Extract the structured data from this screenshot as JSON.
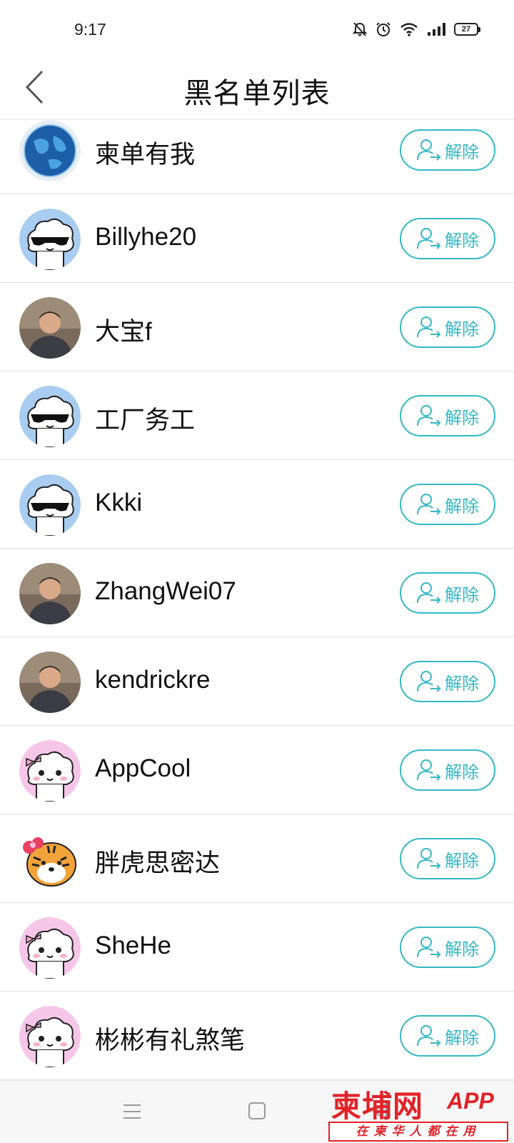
{
  "status_bar": {
    "time": "9:17",
    "battery": "27",
    "icons": [
      "bell-off-icon",
      "alarm-icon",
      "wifi-icon",
      "signal-icon",
      "battery-icon"
    ]
  },
  "header": {
    "title": "黑名单列表",
    "back_icon": "chevron-left-icon"
  },
  "list": {
    "unblock_label": "解除",
    "unblock_icon": "user-arrow-icon",
    "accent_color": "#35b8c6",
    "items": [
      {
        "name": "柬单有我",
        "avatar": "globe"
      },
      {
        "name": "Billyhe20",
        "avatar": "cloud-sunglasses"
      },
      {
        "name": "大宝f",
        "avatar": "photo"
      },
      {
        "name": "工厂务工",
        "avatar": "cloud-sunglasses"
      },
      {
        "name": "Kkki",
        "avatar": "cloud-sunglasses"
      },
      {
        "name": "ZhangWei07",
        "avatar": "photo"
      },
      {
        "name": "kendrickre",
        "avatar": "photo"
      },
      {
        "name": "AppCool",
        "avatar": "cloud-bow"
      },
      {
        "name": "胖虎思密达",
        "avatar": "tiger"
      },
      {
        "name": "SheHe",
        "avatar": "cloud-bow"
      },
      {
        "name": "彬彬有礼煞笔",
        "avatar": "cloud-bow"
      }
    ]
  },
  "nav_bar": {
    "icons": [
      "menu-icon",
      "home-square-icon",
      "back-triangle-icon"
    ]
  },
  "watermark": {
    "brand": "柬埔网",
    "app": "APP",
    "slogan": "在柬华人都在用",
    "color": "#e22228"
  }
}
